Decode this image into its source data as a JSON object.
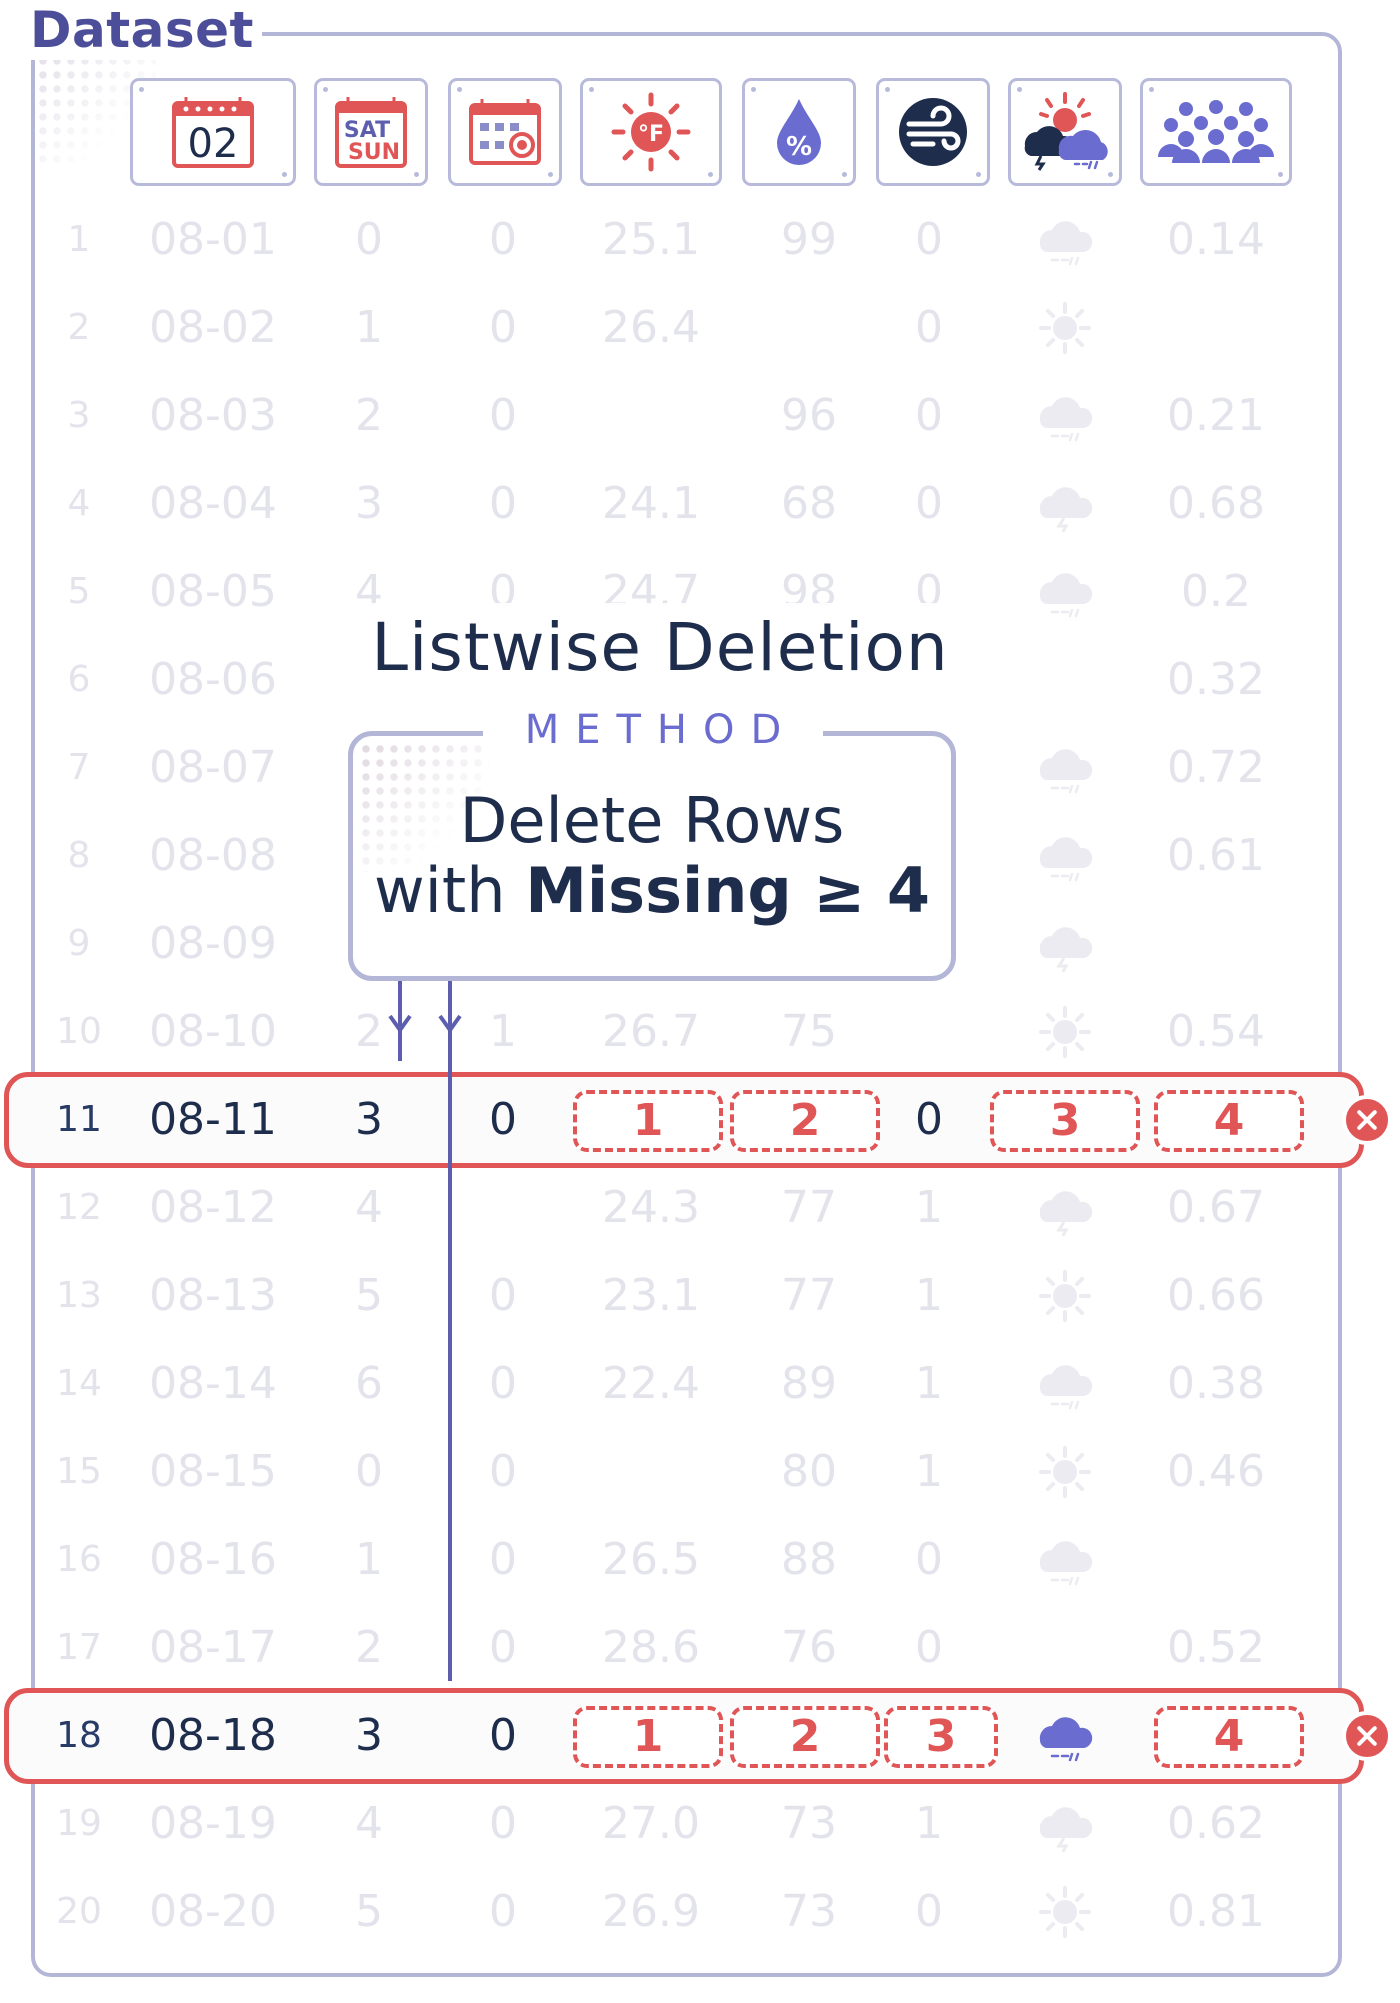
{
  "dataset": {
    "title": "Dataset"
  },
  "columns": [
    {
      "key": "id",
      "icon": "row-number"
    },
    {
      "key": "date",
      "icon": "calendar-date-icon",
      "icon_text": "02"
    },
    {
      "key": "weekday",
      "icon": "weekend-calendar-icon",
      "icon_text_top": "SAT",
      "icon_text_bottom": "SUN"
    },
    {
      "key": "holiday",
      "icon": "holiday-calendar-icon"
    },
    {
      "key": "temp",
      "icon": "temperature-fahrenheit-icon",
      "icon_text": "°F"
    },
    {
      "key": "humidity",
      "icon": "humidity-drop-icon",
      "icon_text": "%"
    },
    {
      "key": "wind",
      "icon": "wind-icon"
    },
    {
      "key": "weather",
      "icon": "weather-condition-icon"
    },
    {
      "key": "count",
      "icon": "crowd-count-icon"
    }
  ],
  "rows": [
    {
      "id": "1",
      "date": "08-01",
      "weekday": "0",
      "holiday": "0",
      "temp": "25.1",
      "humidity": "99",
      "wind": "0",
      "weather": "rain",
      "count": "0.14"
    },
    {
      "id": "2",
      "date": "08-02",
      "weekday": "1",
      "holiday": "0",
      "temp": "26.4",
      "humidity": "",
      "wind": "0",
      "weather": "sun",
      "count": ""
    },
    {
      "id": "3",
      "date": "08-03",
      "weekday": "2",
      "holiday": "0",
      "temp": "",
      "humidity": "96",
      "wind": "0",
      "weather": "rain",
      "count": "0.21"
    },
    {
      "id": "4",
      "date": "08-04",
      "weekday": "3",
      "holiday": "0",
      "temp": "24.1",
      "humidity": "68",
      "wind": "0",
      "weather": "storm",
      "count": "0.68"
    },
    {
      "id": "5",
      "date": "08-05",
      "weekday": "4",
      "holiday": "0",
      "temp": "24.7",
      "humidity": "98",
      "wind": "0",
      "weather": "rain",
      "count": "0.2"
    },
    {
      "id": "6",
      "date": "08-06",
      "weekday": "",
      "holiday": "",
      "temp": "",
      "humidity": "",
      "wind": "",
      "weather": "",
      "count": "0.32"
    },
    {
      "id": "7",
      "date": "08-07",
      "weekday": "",
      "holiday": "",
      "temp": "",
      "humidity": "",
      "wind": "",
      "weather": "rain",
      "count": "0.72"
    },
    {
      "id": "8",
      "date": "08-08",
      "weekday": "",
      "holiday": "",
      "temp": "",
      "humidity": "",
      "wind": "",
      "weather": "rain",
      "count": "0.61"
    },
    {
      "id": "9",
      "date": "08-09",
      "weekday": "",
      "holiday": "",
      "temp": "",
      "humidity": "",
      "wind": "",
      "weather": "storm",
      "count": ""
    },
    {
      "id": "10",
      "date": "08-10",
      "weekday": "2",
      "holiday": "1",
      "temp": "26.7",
      "humidity": "75",
      "wind": "",
      "weather": "sun",
      "count": "0.54"
    },
    {
      "id": "11",
      "date": "08-11",
      "weekday": "3",
      "holiday": "0",
      "temp": "1",
      "humidity": "2",
      "wind": "0",
      "weather": "3",
      "count": "4",
      "missing": [
        "temp",
        "humidity",
        "weather",
        "count"
      ],
      "deleted": true
    },
    {
      "id": "12",
      "date": "08-12",
      "weekday": "4",
      "holiday": "",
      "temp": "24.3",
      "humidity": "77",
      "wind": "1",
      "weather": "storm",
      "count": "0.67"
    },
    {
      "id": "13",
      "date": "08-13",
      "weekday": "5",
      "holiday": "0",
      "temp": "23.1",
      "humidity": "77",
      "wind": "1",
      "weather": "sun",
      "count": "0.66"
    },
    {
      "id": "14",
      "date": "08-14",
      "weekday": "6",
      "holiday": "0",
      "temp": "22.4",
      "humidity": "89",
      "wind": "1",
      "weather": "rain",
      "count": "0.38"
    },
    {
      "id": "15",
      "date": "08-15",
      "weekday": "0",
      "holiday": "0",
      "temp": "",
      "humidity": "80",
      "wind": "1",
      "weather": "sun",
      "count": "0.46"
    },
    {
      "id": "16",
      "date": "08-16",
      "weekday": "1",
      "holiday": "0",
      "temp": "26.5",
      "humidity": "88",
      "wind": "0",
      "weather": "rain",
      "count": ""
    },
    {
      "id": "17",
      "date": "08-17",
      "weekday": "2",
      "holiday": "0",
      "temp": "28.6",
      "humidity": "76",
      "wind": "0",
      "weather": "",
      "count": "0.52"
    },
    {
      "id": "18",
      "date": "08-18",
      "weekday": "3",
      "holiday": "0",
      "temp": "1",
      "humidity": "2",
      "wind": "3",
      "weather": "rain",
      "count": "4",
      "missing": [
        "temp",
        "humidity",
        "wind",
        "count"
      ],
      "deleted": true
    },
    {
      "id": "19",
      "date": "08-19",
      "weekday": "4",
      "holiday": "0",
      "temp": "27.0",
      "humidity": "73",
      "wind": "1",
      "weather": "storm",
      "count": "0.62"
    },
    {
      "id": "20",
      "date": "08-20",
      "weekday": "5",
      "holiday": "0",
      "temp": "26.9",
      "humidity": "73",
      "wind": "0",
      "weather": "sun",
      "count": "0.81"
    }
  ],
  "method": {
    "heading": "Listwise Deletion",
    "tag": "METHOD",
    "line1": "Delete Rows",
    "line2_prefix": "with ",
    "line2_bold": "Missing ≥ 4"
  },
  "colors": {
    "frame": "#b4b6d8",
    "title": "#4c4e9a",
    "text_dark": "#1f2d4d",
    "text_faded": "#e3e3ec",
    "missing_red": "#e05555",
    "accent_purple": "#6a6ccf",
    "connector": "#5d5fae"
  }
}
